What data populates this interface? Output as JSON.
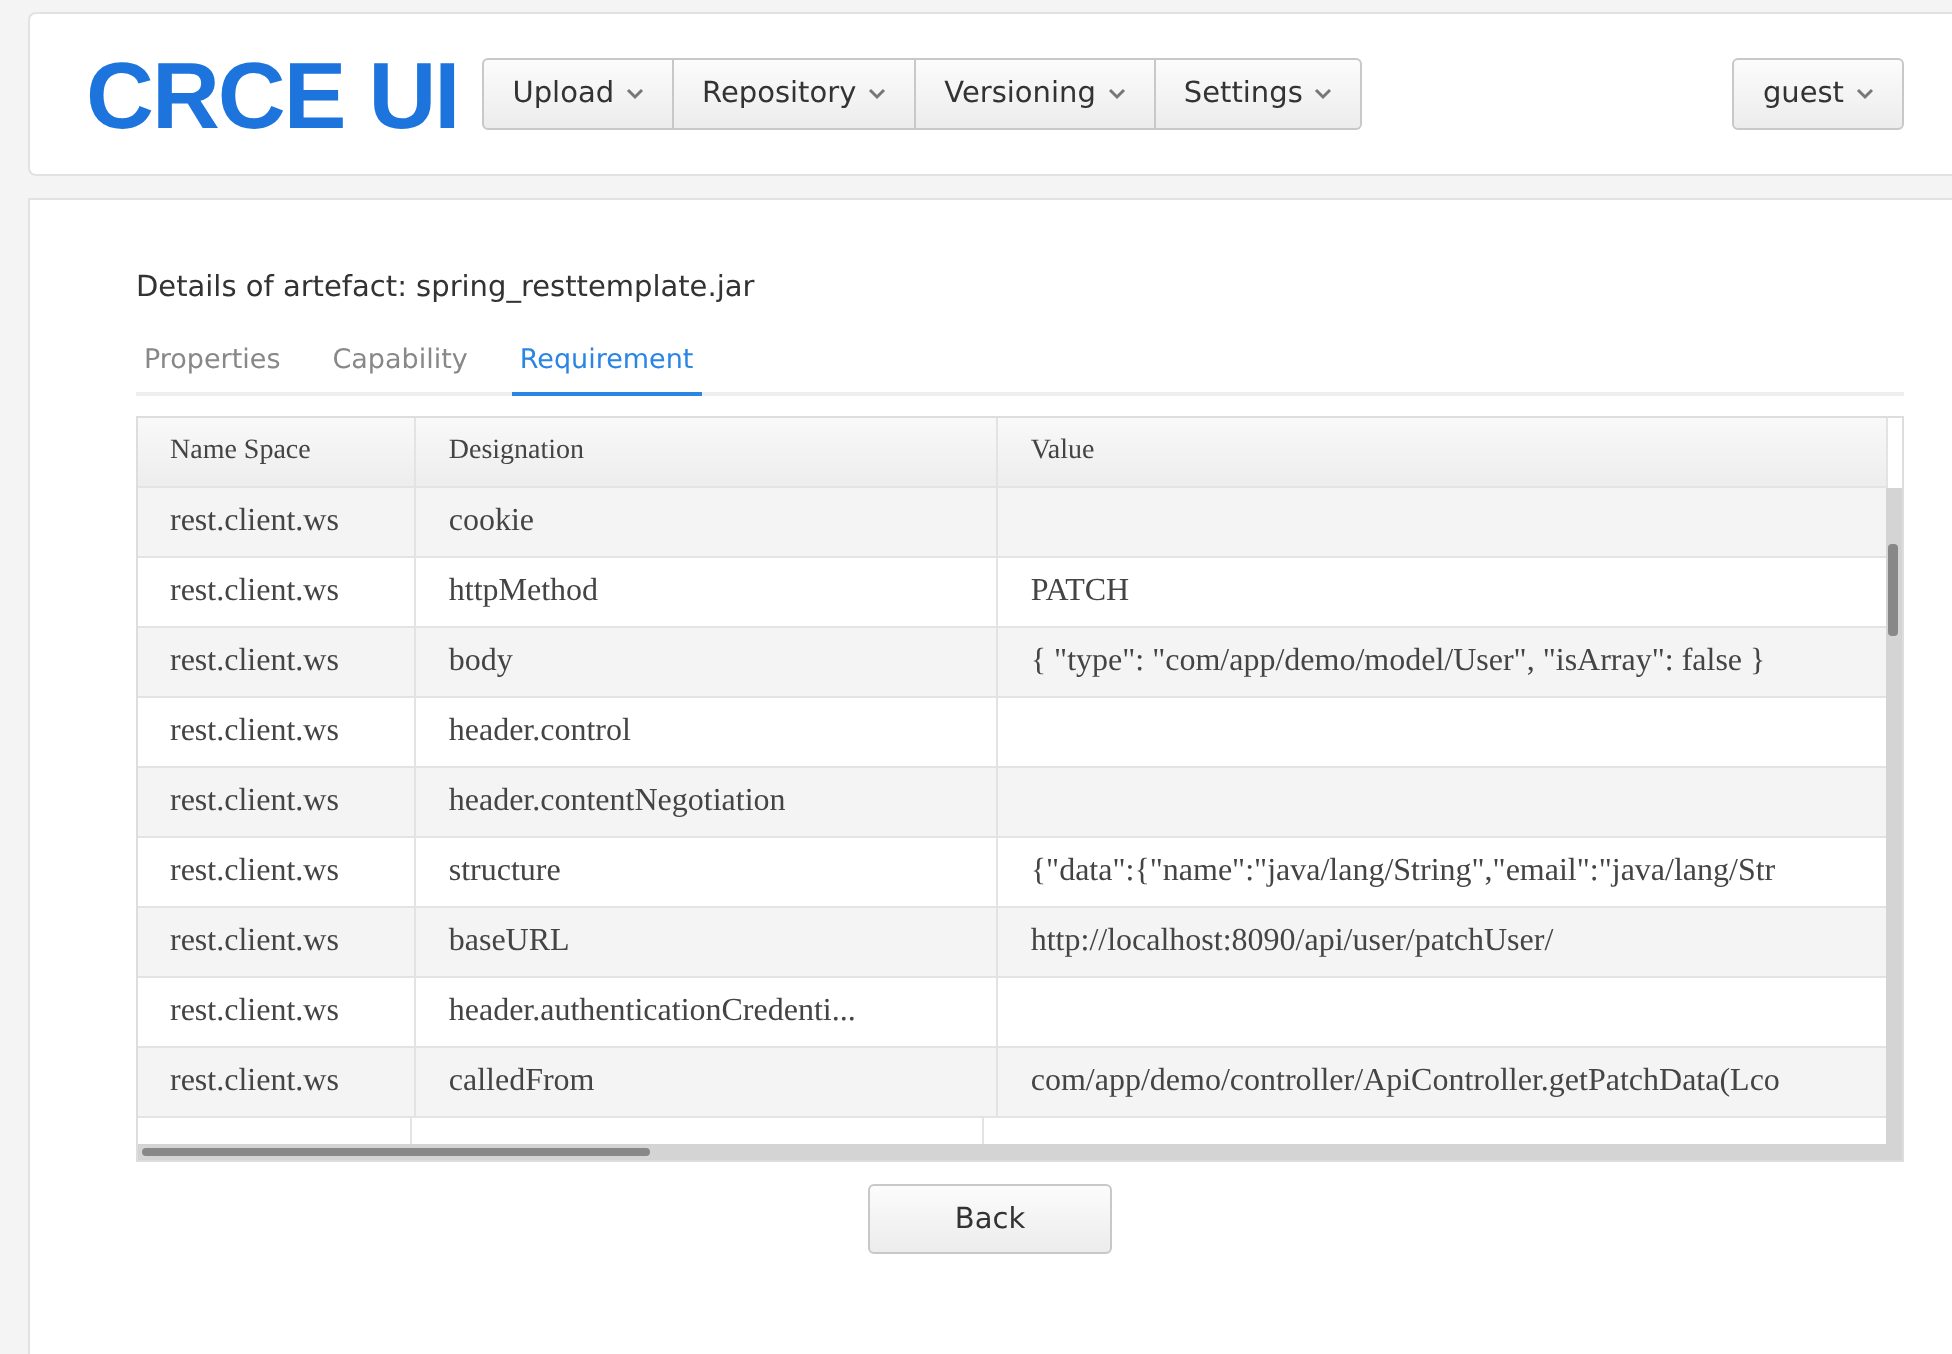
{
  "header": {
    "logo": "CRCE UI",
    "menus": [
      {
        "label": "Upload"
      },
      {
        "label": "Repository"
      },
      {
        "label": "Versioning"
      },
      {
        "label": "Settings"
      }
    ],
    "user_menu": {
      "label": "guest"
    }
  },
  "title": "Details of artefact: spring_resttemplate.jar",
  "tabs": [
    {
      "label": "Properties",
      "selected": false
    },
    {
      "label": "Capability",
      "selected": false
    },
    {
      "label": "Requirement",
      "selected": true
    }
  ],
  "table": {
    "columns": [
      "Name Space",
      "Designation",
      "Value"
    ],
    "rows": [
      {
        "name_space": "rest.client.ws",
        "designation": "cookie",
        "value": ""
      },
      {
        "name_space": "rest.client.ws",
        "designation": "httpMethod",
        "value": "PATCH"
      },
      {
        "name_space": "rest.client.ws",
        "designation": "body",
        "value": "{ \"type\": \"com/app/demo/model/User\", \"isArray\": false }"
      },
      {
        "name_space": "rest.client.ws",
        "designation": "header.control",
        "value": ""
      },
      {
        "name_space": "rest.client.ws",
        "designation": "header.contentNegotiation",
        "value": ""
      },
      {
        "name_space": "rest.client.ws",
        "designation": "structure",
        "value": "{\"data\":{\"name\":\"java/lang/String\",\"email\":\"java/lang/Str"
      },
      {
        "name_space": "rest.client.ws",
        "designation": "baseURL",
        "value": "http://localhost:8090/api/user/patchUser/"
      },
      {
        "name_space": "rest.client.ws",
        "designation": "header.authenticationCredenti...",
        "value": ""
      },
      {
        "name_space": "rest.client.ws",
        "designation": "calledFrom",
        "value": "com/app/demo/controller/ApiController.getPatchData(Lco"
      }
    ]
  },
  "back_button": "Back"
}
